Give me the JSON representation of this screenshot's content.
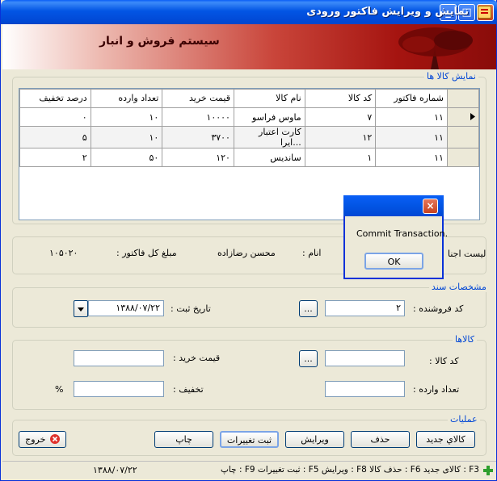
{
  "window": {
    "title": "نمایش و ویرایش فاکتور ورودی",
    "close": "×",
    "max": "□",
    "min": "_"
  },
  "banner": {
    "text": "سیستم فروش و انبار"
  },
  "goods_group": {
    "legend": "نمایش کالا ها"
  },
  "table": {
    "columns": [
      "شماره فاکتور",
      "کد کالا",
      "نام کالا",
      "قیمت خرید",
      "تعداد وارده",
      "درصد تخفیف"
    ],
    "rows": [
      [
        "١١",
        "٧",
        "ماوس فراسو",
        "١٠٠٠٠",
        "١٠",
        "٠"
      ],
      [
        "١١",
        "١٢",
        "کارت اعتبار ایرا...",
        "٣٧٠٠",
        "١٠",
        "۵"
      ],
      [
        "١١",
        "١",
        "ساندیس",
        "١٢٠",
        "۵٠",
        "٢"
      ]
    ]
  },
  "info": {
    "list_label": "لیست اجنا",
    "name_label": "انام :",
    "name_value": "محسن رضازاده",
    "total_label": "مبلغ کل فاکتور :",
    "total_value": "١٠۵٠٢٠"
  },
  "doc_group": {
    "legend": "مشخصات سند",
    "seller_label": "کد فروشنده :",
    "seller_value": "٢",
    "browse": "...",
    "date_label": "تاریخ ثبت :",
    "date_value": "١٣٨٨/٠٧/٢٢"
  },
  "goods_form": {
    "legend": "کالاها",
    "code_label": "کد کالا :",
    "browse": "...",
    "price_label": "قیمت خرید :",
    "qty_label": "تعداد وارده :",
    "discount_label": "تخفیف :",
    "percent": "%"
  },
  "ops": {
    "legend": "عملیات",
    "new_item": "کالاي جديد",
    "delete": "حذف",
    "edit": "ویرایش",
    "save": "ثبت تغییرات",
    "print": "چاپ",
    "exit": "خروج"
  },
  "dialog": {
    "message": "Commit Transaction.",
    "ok": "OK",
    "close": "×"
  },
  "status": {
    "text": "F3 : کالای جدید  F6 : حذف کالا  F8 : ویرایش  F5 : ثبت تغییرات  F9 : چاپ",
    "date": "١٣٨٨/٠٧/٢٢"
  }
}
